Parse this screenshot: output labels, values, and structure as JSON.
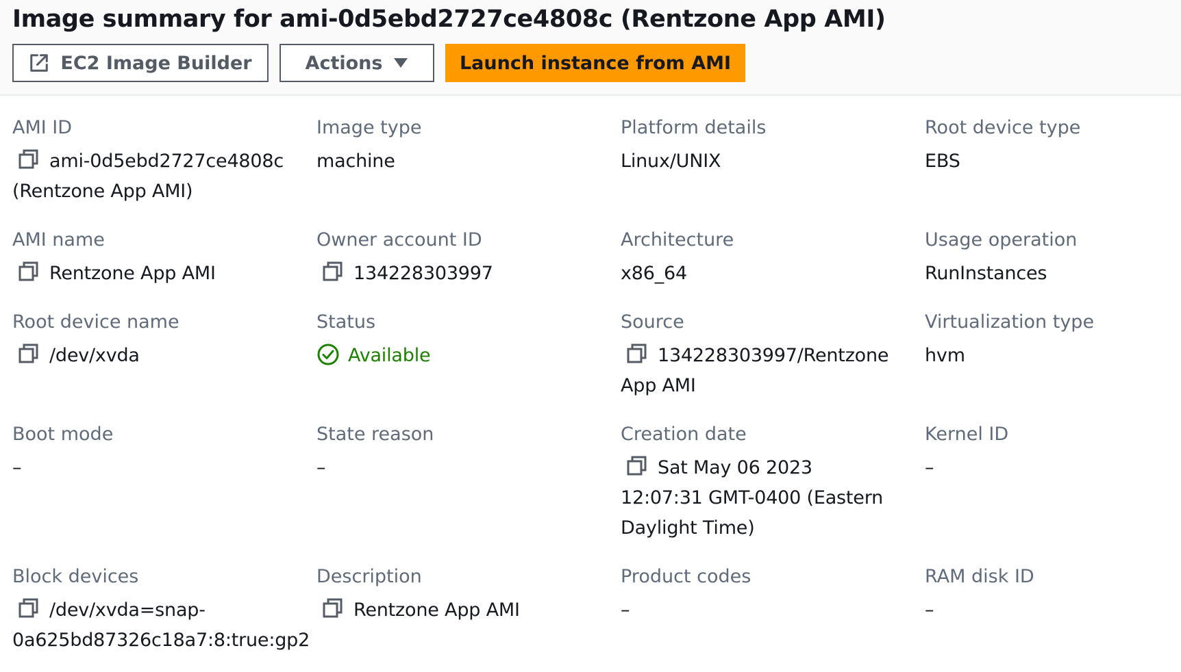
{
  "header": {
    "title": "Image summary for ami-0d5ebd2727ce4808c (Rentzone App AMI)",
    "buttons": {
      "image_builder": "EC2 Image Builder",
      "actions": "Actions",
      "launch": "Launch instance from AMI"
    }
  },
  "colors": {
    "primary_button": "#ff9900",
    "status_available": "#1d8102",
    "label_text": "#5f6b7a"
  },
  "details": {
    "ami_id": {
      "label": "AMI ID",
      "value": "ami-0d5ebd2727ce4808c (Rentzone App AMI)"
    },
    "image_type": {
      "label": "Image type",
      "value": "machine"
    },
    "platform_details": {
      "label": "Platform details",
      "value": "Linux/UNIX"
    },
    "root_device_type": {
      "label": "Root device type",
      "value": "EBS"
    },
    "ami_name": {
      "label": "AMI name",
      "value": "Rentzone App AMI"
    },
    "owner_account_id": {
      "label": "Owner account ID",
      "value": "134228303997"
    },
    "architecture": {
      "label": "Architecture",
      "value": "x86_64"
    },
    "usage_operation": {
      "label": "Usage operation",
      "value": "RunInstances"
    },
    "root_device_name": {
      "label": "Root device name",
      "value": "/dev/xvda"
    },
    "status": {
      "label": "Status",
      "value": "Available"
    },
    "source": {
      "label": "Source",
      "value": "134228303997/Rentzone App AMI"
    },
    "virtualization_type": {
      "label": "Virtualization type",
      "value": "hvm"
    },
    "boot_mode": {
      "label": "Boot mode",
      "value": "–"
    },
    "state_reason": {
      "label": "State reason",
      "value": "–"
    },
    "creation_date": {
      "label": "Creation date",
      "value": "Sat May 06 2023 12:07:31 GMT-0400 (Eastern Daylight Time)"
    },
    "kernel_id": {
      "label": "Kernel ID",
      "value": "–"
    },
    "block_devices": {
      "label": "Block devices",
      "value": "/dev/xvda=snap-0a625bd87326c18a7:8:true:gp2"
    },
    "description": {
      "label": "Description",
      "value": "Rentzone App AMI"
    },
    "product_codes": {
      "label": "Product codes",
      "value": "–"
    },
    "ram_disk_id": {
      "label": "RAM disk ID",
      "value": "–"
    }
  },
  "icons": {
    "copy": "copy-icon",
    "external_link": "external-link-icon",
    "dropdown": "caret-down-icon",
    "status": "check-circle-icon"
  }
}
